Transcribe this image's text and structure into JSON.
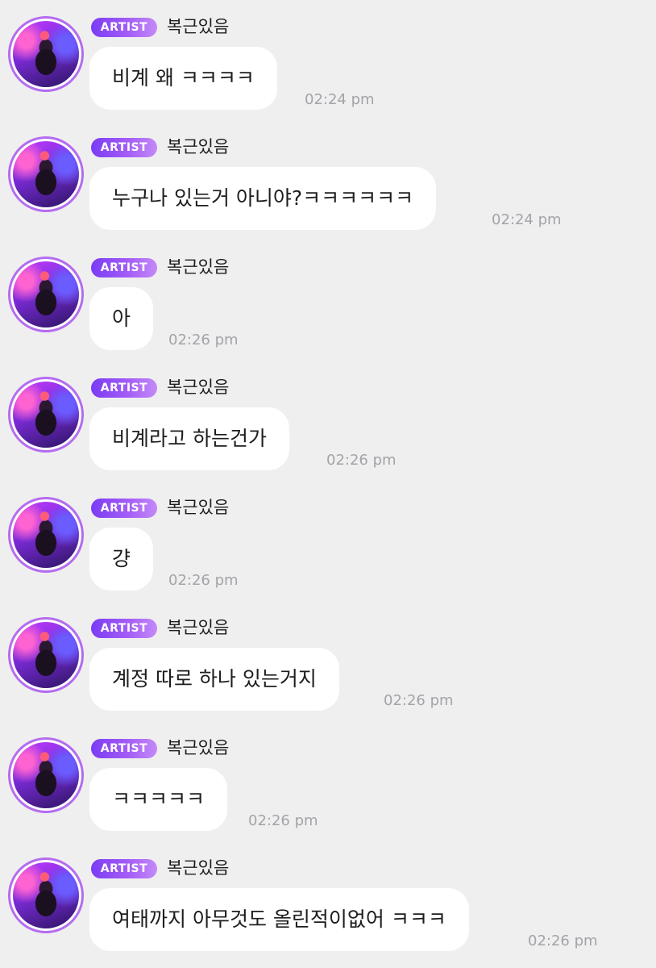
{
  "badge_label": "ARTIST",
  "messages": [
    {
      "sender": "복근있음",
      "text": "비계 왜 ㅋㅋㅋㅋ",
      "time": "02:24 pm"
    },
    {
      "sender": "복근있음",
      "text": "누구나 있는거 아니야?ㅋㅋㅋㅋㅋㅋ",
      "time": "02:24 pm"
    },
    {
      "sender": "복근있음",
      "text": "아",
      "time": "02:26 pm"
    },
    {
      "sender": "복근있음",
      "text": "비계라고 하는건가",
      "time": "02:26 pm"
    },
    {
      "sender": "복근있음",
      "text": "걍",
      "time": "02:26 pm"
    },
    {
      "sender": "복근있음",
      "text": "계정 따로 하나 있는거지",
      "time": "02:26 pm"
    },
    {
      "sender": "복근있음",
      "text": "ㅋㅋㅋㅋㅋ",
      "time": "02:26 pm"
    },
    {
      "sender": "복근있음",
      "text": "여태까지 아무것도 올린적이없어 ㅋㅋㅋ",
      "time": "02:26 pm"
    }
  ]
}
